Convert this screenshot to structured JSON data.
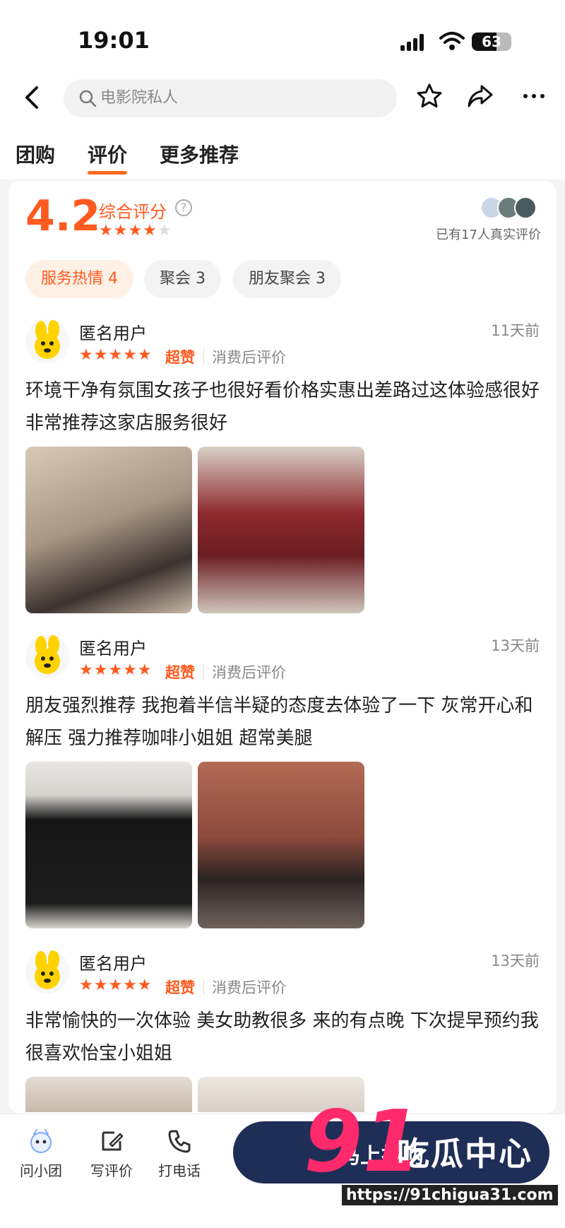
{
  "status_bar": {
    "time": "19:01",
    "battery": "63"
  },
  "nav": {
    "search_placeholder": "电影院私人"
  },
  "tabs": [
    {
      "label": "团购"
    },
    {
      "label": "评价"
    },
    {
      "label": "更多推荐"
    }
  ],
  "summary": {
    "score": "4.2",
    "score_label": "综合评分",
    "stars_display": 4,
    "review_count_text": "已有17人真实评价"
  },
  "chips": [
    {
      "label": "服务热情 4"
    },
    {
      "label": "聚会 3"
    },
    {
      "label": "朋友聚会 3"
    }
  ],
  "reviews": [
    {
      "user": "匿名用户",
      "time": "11天前",
      "stars": "★★★★★",
      "badge": "超赞",
      "meta": "消费后评价",
      "text": "环境干净有氛围女孩子也很好看价格实惠出差路过这体验感很好非常推荐这家店服务很好"
    },
    {
      "user": "匿名用户",
      "time": "13天前",
      "stars": "★★★★★",
      "badge": "超赞",
      "meta": "消费后评价",
      "text": "朋友强烈推荐 我抱着半信半疑的态度去体验了一下 灰常开心和解压 强力推荐咖啡小姐姐 超常美腿"
    },
    {
      "user": "匿名用户",
      "time": "13天前",
      "stars": "★★★★★",
      "badge": "超赞",
      "meta": "消费后评价",
      "text": "非常愉快的一次体验 美女助教很多 来的有点晚 下次提早预约我很喜欢怡宝小姐姐"
    }
  ],
  "bottom_bar": {
    "ask": "问小团",
    "write_review": "写评价",
    "call": "打电话",
    "buy_label": "马上抢购"
  },
  "watermark": {
    "number": "91",
    "brand": "吃瓜中心",
    "url": "https://91chigua31.com"
  },
  "colors": {
    "accent": "#ff5a1f",
    "tab_underline": "#ff6a1a",
    "buy_button": "#1f2e57",
    "watermark_pink": "#ff2a6b"
  }
}
